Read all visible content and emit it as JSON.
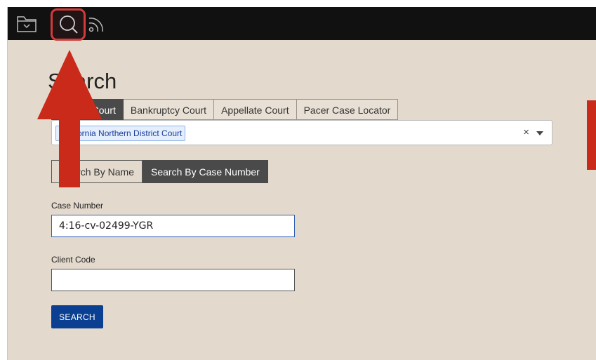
{
  "topbar": {
    "icons": [
      "folder-icon",
      "search-icon",
      "feed-icon"
    ]
  },
  "page": {
    "title": "Search"
  },
  "tabs": [
    {
      "label": "District Court",
      "active": true
    },
    {
      "label": "Bankruptcy Court",
      "active": false
    },
    {
      "label": "Appellate Court",
      "active": false
    },
    {
      "label": "Pacer Case Locator",
      "active": false
    }
  ],
  "court_select": {
    "selected": "California Northern District Court",
    "clear": "×"
  },
  "search_mode": {
    "by_name": "Search By Name",
    "by_case_number": "Search By Case Number",
    "active": "by_case_number"
  },
  "case_number": {
    "label": "Case Number",
    "value": "4:16-cv-02499-YGR"
  },
  "client_code": {
    "label": "Client Code",
    "value": ""
  },
  "search_button": {
    "label": "SEARCH"
  },
  "colors": {
    "background": "#e3d9cc",
    "topbar": "#111111",
    "highlight": "#d43a3a",
    "annotation_arrow": "#c92a1a",
    "button": "#0a3f92"
  }
}
